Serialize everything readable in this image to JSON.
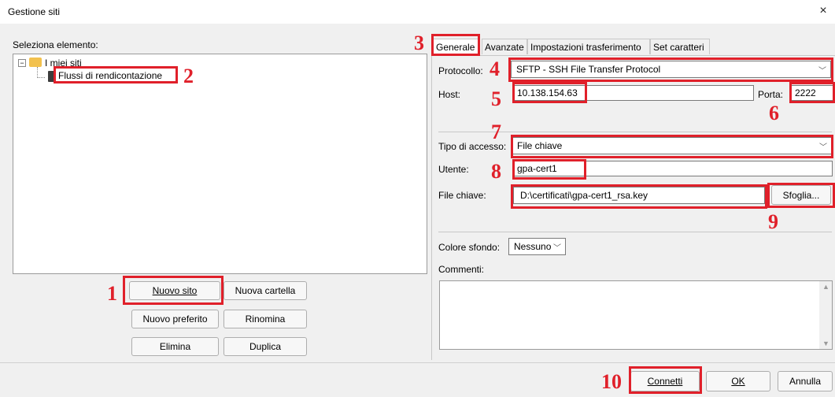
{
  "window": {
    "title": "Gestione siti",
    "close_glyph": "×"
  },
  "left": {
    "select_label": "Seleziona elemento:",
    "tree": {
      "root_label": "I miei siti",
      "child_label": "Flussi di rendicontazione"
    },
    "buttons": {
      "new_site": "Nuovo sito",
      "new_folder": "Nuova cartella",
      "new_bookmark": "Nuovo preferito",
      "rename": "Rinomina",
      "delete": "Elimina",
      "duplicate": "Duplica"
    }
  },
  "tabs": [
    "Generale",
    "Avanzate",
    "Impostazioni trasferimento",
    "Set caratteri"
  ],
  "general": {
    "protocol_label": "Protocollo:",
    "protocol_value": "SFTP - SSH File Transfer Protocol",
    "host_label": "Host:",
    "host_value": "10.138.154.63",
    "port_label": "Porta:",
    "port_value": "2222",
    "logon_label": "Tipo di accesso:",
    "logon_value": "File chiave",
    "user_label": "Utente:",
    "user_value": "gpa-cert1",
    "keyfile_label": "File chiave:",
    "keyfile_value": "D:\\certificati\\gpa-cert1_rsa.key",
    "browse_label": "Sfoglia...",
    "bgcolor_label": "Colore sfondo:",
    "bgcolor_value": "Nessuno",
    "comments_label": "Commenti:"
  },
  "footer": {
    "connect": "Connetti",
    "ok": "OK",
    "cancel": "Annulla"
  },
  "annotations": [
    "1",
    "2",
    "3",
    "4",
    "5",
    "6",
    "7",
    "8",
    "9",
    "10"
  ],
  "colors": {
    "annotation_red": "#e0202a",
    "folder_yellow": "#f2c14e"
  }
}
